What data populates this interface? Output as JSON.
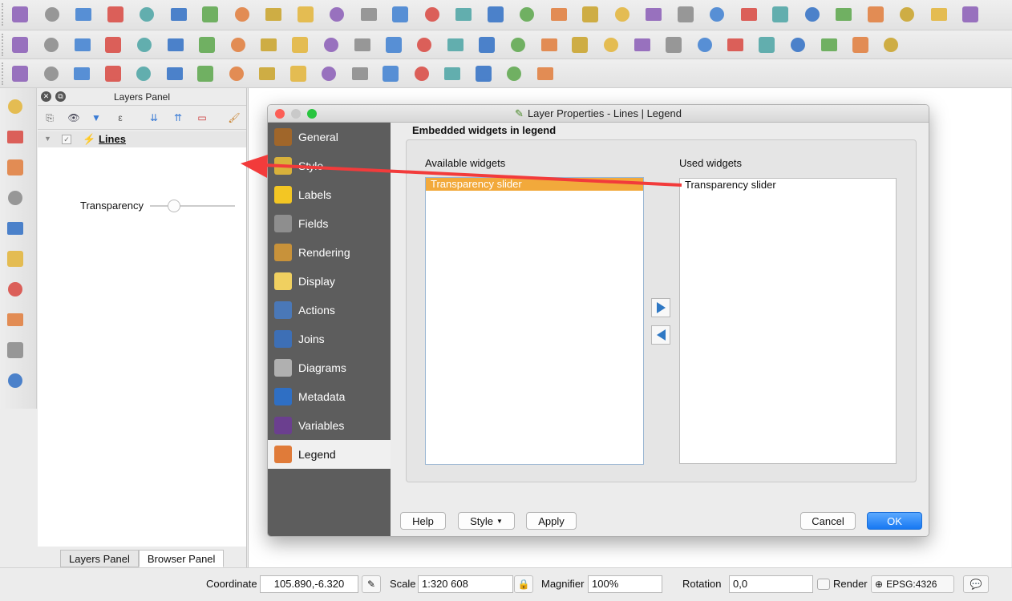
{
  "toolbar_icons": {
    "row1": [
      "new-project-icon",
      "open-project-icon",
      "save-project-icon",
      "save-as-icon",
      "new-print-composer-icon",
      "composer-manager-icon",
      "pan-icon",
      "pan-to-selection-icon",
      "zoom-in-icon",
      "zoom-out-icon",
      "zoom-native-icon",
      "zoom-full-icon",
      "zoom-to-selection-icon",
      "zoom-to-layer-icon",
      "zoom-last-icon",
      "zoom-next-icon",
      "new-map-view-icon",
      "bookmark-icon",
      "refresh-icon",
      "identify-icon",
      "select-measure-icon",
      "select-features-icon",
      "expression-select-icon",
      "deselect-icon",
      "attribute-table-icon",
      "field-calculator-icon",
      "statistics-icon",
      "measure-icon",
      "annotation-icon",
      "overflow-icon",
      "help-icon"
    ],
    "row2": [
      "edits-icon",
      "toggle-editing-icon",
      "save-edits-icon",
      "add-feature-icon",
      "node-tool-icon",
      "move-feature-icon",
      "digitize-icon",
      "delete-selected-icon",
      "cut-features-icon",
      "copy-features-icon",
      "paste-features-icon",
      "label-icon",
      "pin-label-icon",
      "show-hide-labels-icon",
      "move-label-icon",
      "rotate-label-icon",
      "change-label-icon",
      "label-settings-icon",
      "label-style-icon",
      "wms-icon",
      "csw-icon",
      "python-icon",
      "north-arrow-icon",
      "scale-bar-icon",
      "copyright-icon",
      "georeferencer-icon",
      "wand-icon",
      "layer-notes-icon",
      "layer-props-icon"
    ],
    "row3": [
      "measure-angle-icon",
      "snapping-icon",
      "undo-icon",
      "redo-icon",
      "simplify-icon",
      "add-ring-icon",
      "add-part-icon",
      "fill-ring-icon",
      "delete-ring-icon",
      "delete-part-icon",
      "reshape-icon",
      "offset-curve-icon",
      "split-features-icon",
      "split-parts-icon",
      "merge-features-icon",
      "merge-attributes-icon",
      "rotate-symbols-icon",
      "trace-icon"
    ]
  },
  "left_toolbar_icons": [
    "add-vector-layer-icon",
    "add-raster-layer-icon",
    "add-delimited-text-icon",
    "add-postgis-icon",
    "add-spatialite-icon",
    "add-wms-icon",
    "add-wcs-icon",
    "add-wfs-icon",
    "add-virtual-layer-icon",
    "new-shapefile-icon"
  ],
  "layers_panel": {
    "title": "Layers Panel",
    "layer_name": "Lines",
    "widget_label": "Transparency",
    "transparency_value": 0.28,
    "tabs": [
      "Layers Panel",
      "Browser Panel"
    ]
  },
  "dialog": {
    "title": "Layer Properties - Lines | Legend",
    "nav": [
      {
        "label": "General",
        "icon": "general-icon",
        "color": "#a0662a"
      },
      {
        "label": "Style",
        "icon": "style-icon",
        "color": "#d8b13b"
      },
      {
        "label": "Labels",
        "icon": "labels-icon",
        "color": "#f3c623"
      },
      {
        "label": "Fields",
        "icon": "fields-icon",
        "color": "#8e8e8e"
      },
      {
        "label": "Rendering",
        "icon": "rendering-icon",
        "color": "#c8923a"
      },
      {
        "label": "Display",
        "icon": "display-icon",
        "color": "#f0d060"
      },
      {
        "label": "Actions",
        "icon": "actions-icon",
        "color": "#4a78b8"
      },
      {
        "label": "Joins",
        "icon": "joins-icon",
        "color": "#3d6fb6"
      },
      {
        "label": "Diagrams",
        "icon": "diagrams-icon",
        "color": "#b0b0b0"
      },
      {
        "label": "Metadata",
        "icon": "metadata-icon",
        "color": "#2f6fc4"
      },
      {
        "label": "Variables",
        "icon": "variables-icon",
        "color": "#6b3f8f"
      },
      {
        "label": "Legend",
        "icon": "legend-icon",
        "color": "#e07b39"
      }
    ],
    "active_nav": "Legend",
    "group_title": "Embedded widgets in legend",
    "available_label": "Available widgets",
    "used_label": "Used widgets",
    "available_items": [
      "Transparency slider"
    ],
    "used_items": [
      "Transparency slider"
    ],
    "buttons": {
      "help": "Help",
      "style": "Style",
      "apply": "Apply",
      "cancel": "Cancel",
      "ok": "OK"
    },
    "window_controls": {
      "close": "#fc5f57",
      "minimize": "#c9c9c9",
      "maximize": "#29c53f"
    }
  },
  "statusbar": {
    "coordinate_label": "Coordinate",
    "coordinate_value": "105.890,-6.320",
    "scale_label": "Scale",
    "scale_value": "1:320 608",
    "magnifier_label": "Magnifier",
    "magnifier_value": "100%",
    "rotation_label": "Rotation",
    "rotation_value": "0,0",
    "render_label": "Render",
    "crs_value": "EPSG:4326"
  },
  "colors": {
    "annotation_arrow": "#f23b3b",
    "selection": "#f2a93b",
    "ok_button": "#1778f2"
  }
}
